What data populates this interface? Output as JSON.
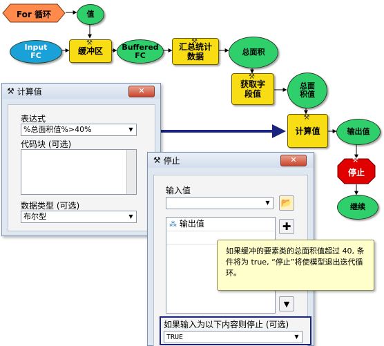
{
  "diagram": {
    "for_loop": "For 循环",
    "value": "值",
    "input_fc": [
      "Input",
      "FC"
    ],
    "buffer": "缓冲区",
    "buffered_fc": [
      "Buffered",
      "FC"
    ],
    "summary_stats": [
      "汇总统计",
      "数据"
    ],
    "total_area": "总面积",
    "get_field_value": [
      "获取字",
      "段值"
    ],
    "total_area_value": [
      "总面",
      "积值"
    ],
    "calculate_value": "计算值",
    "output_value": "输出值",
    "stop": "停止",
    "continue": "继续"
  },
  "calc_dialog": {
    "title": "计算值",
    "close": "✕",
    "expression_label": "表达式",
    "expression_value": "%总面积值%>40%",
    "code_block_label": "代码块 (可选)",
    "data_type_label": "数据类型 (可选)",
    "data_type_value": "布尔型"
  },
  "stop_dialog": {
    "title": "停止",
    "close": "✕",
    "input_value_label": "输入值",
    "input_value": "",
    "list_item": "输出值",
    "stop_if_label": "如果输入为以下内容则停止 (可选)",
    "stop_if_value": "TRUE"
  },
  "tooltip": {
    "text": "如果缓冲的要素类的总面积值超过 40, 条件将为 true, “停止”将使模型退出迭代循环。"
  },
  "colors": {
    "tool_yellow": "#f9dd14",
    "variable_green": "#2fd06c",
    "input_blue": "#1aa2d8",
    "iterator_orange": "#ff8a4c",
    "stop_red": "#e00000",
    "arrow_navy": "#1a237e",
    "tooltip_bg": "#ffffcc"
  }
}
